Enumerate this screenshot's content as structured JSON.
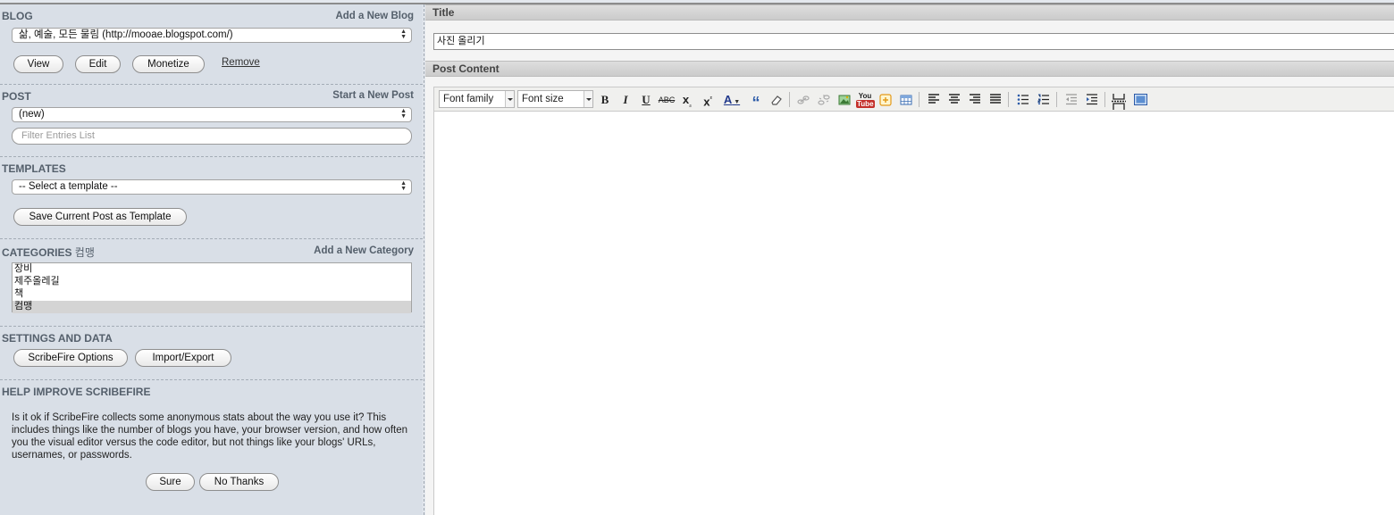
{
  "sidebar": {
    "blog": {
      "title": "BLOG",
      "add_link": "Add a New Blog",
      "selected": "삶, 예술, 모든 물림 (http://mooae.blogspot.com/)",
      "buttons": {
        "view": "View",
        "edit": "Edit",
        "monetize": "Monetize"
      },
      "remove": "Remove"
    },
    "post": {
      "title": "POST",
      "new_link": "Start a New Post",
      "selected": "(new)",
      "filter_placeholder": "Filter Entries List"
    },
    "templates": {
      "title": "TEMPLATES",
      "selected": "-- Select a template --",
      "save_button": "Save Current Post as Template"
    },
    "categories": {
      "title": "CATEGORIES",
      "current": "컴맹",
      "add_link": "Add a New Category",
      "items": [
        "장비",
        "제주올레길",
        "책",
        "컴맹"
      ]
    },
    "settings": {
      "title": "SETTINGS AND DATA",
      "options_button": "ScribeFire Options",
      "import_button": "Import/Export"
    },
    "help": {
      "title": "HELP IMPROVE SCRIBEFIRE",
      "text": "Is it ok if ScribeFire collects some anonymous stats about the way you use it? This includes things like the number of blogs you have, your browser version, and how often you the visual editor versus the code editor, but not things like your blogs' URLs, usernames, or passwords.",
      "sure": "Sure",
      "no_thanks": "No Thanks"
    }
  },
  "editor": {
    "title_label": "Title",
    "title_value": "사진 올리기",
    "content_label": "Post Content",
    "toolbar": {
      "font_family": "Font family",
      "font_size": "Font size",
      "bold": "B",
      "italic": "I",
      "underline": "U",
      "strike": "ABC",
      "subscript": "x",
      "superscript": "x",
      "text_color": "A",
      "quote": "“",
      "youtube_you": "You",
      "youtube_tube": "Tube"
    }
  },
  "colors": {
    "sidebar_bg": "#d9dfe7",
    "section_title": "#55606c",
    "youtube_red": "#c4302b"
  }
}
